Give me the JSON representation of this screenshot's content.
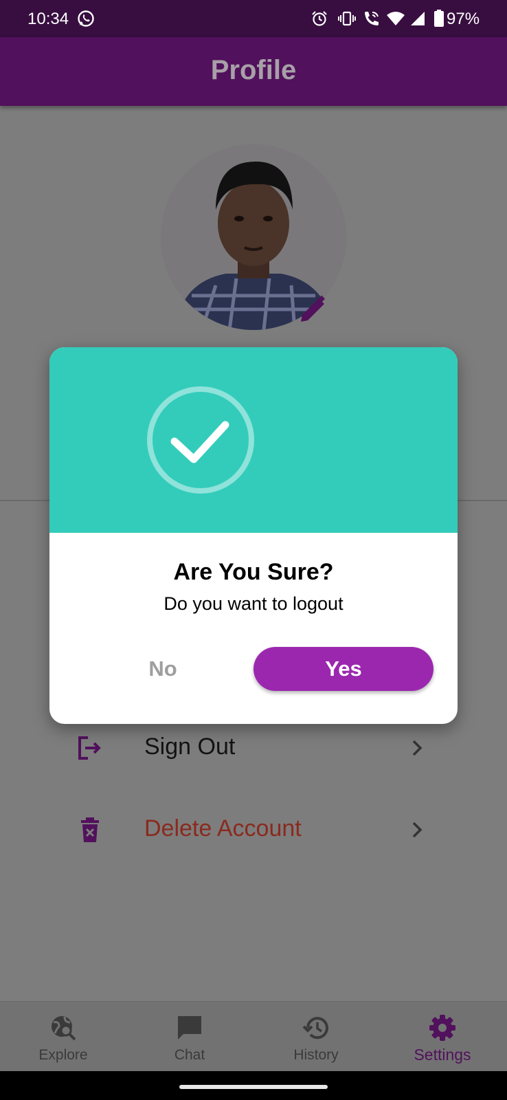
{
  "status_bar": {
    "time": "10:34",
    "battery": "97%"
  },
  "app_bar": {
    "title": "Profile"
  },
  "settings": [
    {
      "label": "Sign Out",
      "icon": "sign-out-icon"
    },
    {
      "label": "Delete Account",
      "icon": "delete-account-icon"
    }
  ],
  "dialog": {
    "title": "Are You Sure?",
    "message": "Do you want to logout",
    "no_label": "No",
    "yes_label": "Yes",
    "header_color": "#33ccbb",
    "yes_color": "#9b27af"
  },
  "bottom_nav": [
    {
      "label": "Explore",
      "icon": "explore-icon",
      "active": false
    },
    {
      "label": "Chat",
      "icon": "chat-icon",
      "active": false
    },
    {
      "label": "History",
      "icon": "history-icon",
      "active": false
    },
    {
      "label": "Settings",
      "icon": "settings-gear-icon",
      "active": true
    }
  ],
  "colors": {
    "primary": "#51115c",
    "accent": "#9b27af",
    "danger": "#8a2a1e"
  }
}
